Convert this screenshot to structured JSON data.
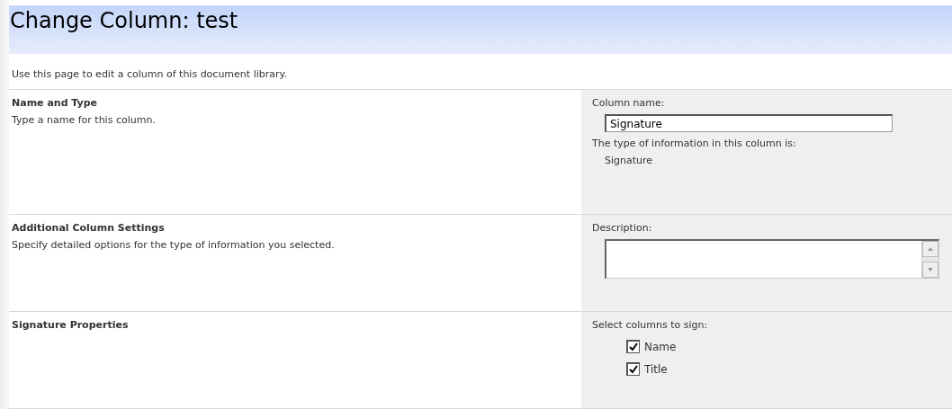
{
  "title": "Change Column: test",
  "intro": "Use this page to edit a column of this document library.",
  "sections": [
    {
      "heading": "Name and Type",
      "description": "Type a name for this column.",
      "kind": "name",
      "field_label": "Column name:",
      "value": "Signature",
      "info_label": "The type of information in this column is:",
      "info_value": "Signature"
    },
    {
      "heading": "Additional Column Settings",
      "description": "Specify detailed options for the type of information you selected.",
      "kind": "textarea",
      "field_label": "Description:"
    },
    {
      "heading": "Signature Properties",
      "kind": "checkboxes",
      "field_label": "Select columns to sign:",
      "options": [
        {
          "label": "Name",
          "checked": true
        },
        {
          "label": "Title",
          "checked": true
        }
      ]
    }
  ]
}
